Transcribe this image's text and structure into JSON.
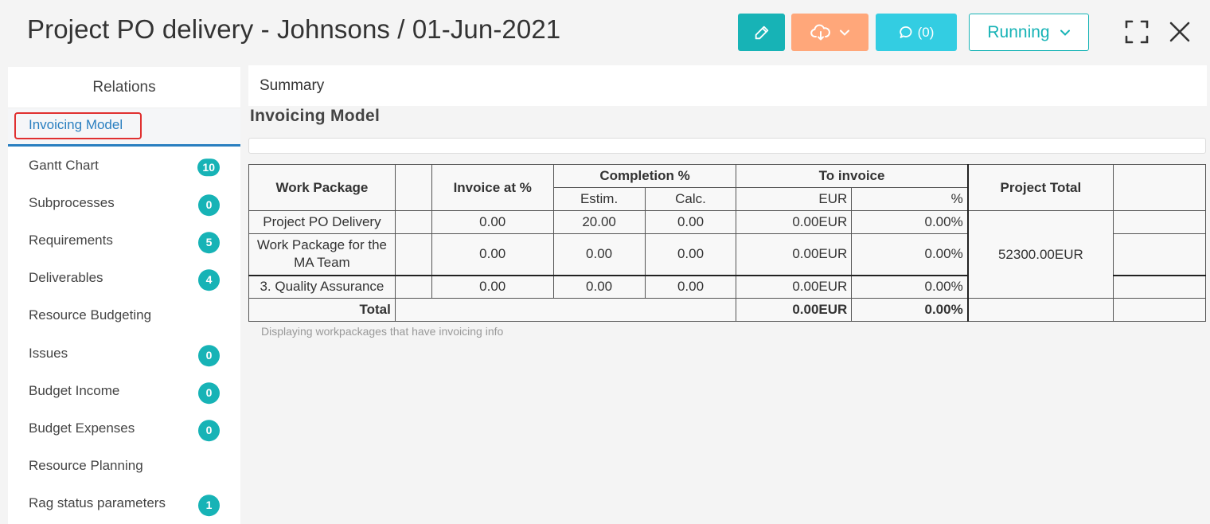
{
  "header": {
    "title": "Project PO delivery - Johnsons / 01-Jun-2021",
    "comments_label": "(0)",
    "status_label": "Running"
  },
  "colors": {
    "accent": "#17b3b6",
    "download": "#ffa77a",
    "comments": "#33cde2",
    "active_link": "#2a7fc0",
    "highlight_box": "#e03030"
  },
  "sidebar": {
    "heading": "Relations",
    "items": [
      {
        "label": "Invoicing Model",
        "badge": ""
      },
      {
        "label": "Gantt Chart",
        "badge": "10"
      },
      {
        "label": "Subprocesses",
        "badge": "0"
      },
      {
        "label": "Requirements",
        "badge": "5"
      },
      {
        "label": "Deliverables",
        "badge": "4"
      },
      {
        "label": "Resource Budgeting",
        "badge": ""
      },
      {
        "label": "Issues",
        "badge": "0"
      },
      {
        "label": "Budget Income",
        "badge": "0"
      },
      {
        "label": "Budget Expenses",
        "badge": "0"
      },
      {
        "label": "Resource Planning",
        "badge": ""
      },
      {
        "label": "Rag status parameters",
        "badge": "1"
      }
    ]
  },
  "main": {
    "tab_summary": "Summary",
    "section_title": "Invoicing Model",
    "table": {
      "headers": {
        "work_package": "Work Package",
        "invoice_at": "Invoice at %",
        "completion": "Completion %",
        "estim": "Estim.",
        "calc": "Calc.",
        "to_invoice": "To invoice",
        "eur": "EUR",
        "pct": "%",
        "project_total": "Project Total"
      },
      "rows": [
        {
          "name": "Project PO Delivery",
          "invoice_at": "0.00",
          "estim": "20.00",
          "calc": "0.00",
          "eur": "0.00EUR",
          "pct": "0.00%"
        },
        {
          "name": "Work Package for the MA Team",
          "invoice_at": "0.00",
          "estim": "0.00",
          "calc": "0.00",
          "eur": "0.00EUR",
          "pct": "0.00%"
        },
        {
          "name": "3. Quality Assurance",
          "invoice_at": "0.00",
          "estim": "0.00",
          "calc": "0.00",
          "eur": "0.00EUR",
          "pct": "0.00%"
        }
      ],
      "project_total_value": "52300.00EUR",
      "total": {
        "label": "Total",
        "eur": "0.00EUR",
        "pct": "0.00%"
      }
    },
    "note": "Displaying workpackages that have invoicing info"
  }
}
